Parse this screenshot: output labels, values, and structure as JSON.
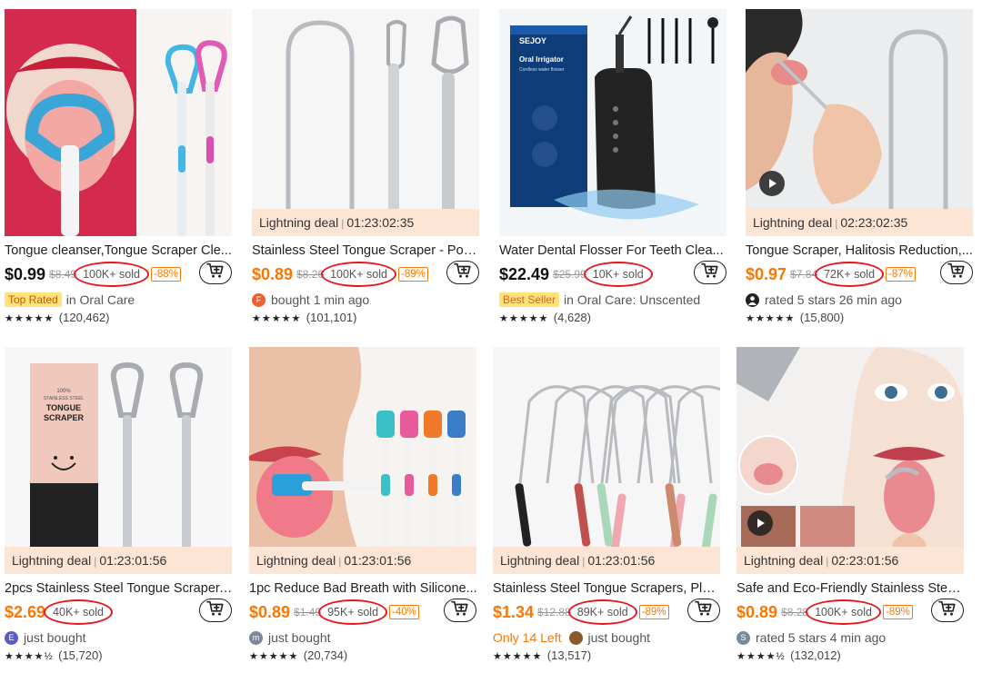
{
  "products": [
    {
      "title": "Tongue cleanser,Tongue Scraper Cle...",
      "price": "$0.99",
      "price_color": "black",
      "original_price": "$8.49",
      "sold": "100K+ sold",
      "discount": "-88%",
      "deal": null,
      "info": {
        "type": "badge",
        "badge": "Top Rated",
        "text": "in Oral Care"
      },
      "stars": "★★★★★",
      "reviews": "(120,462)"
    },
    {
      "title": "Stainless Steel Tongue Scraper - Port...",
      "price": "$0.89",
      "price_color": "orange",
      "original_price": "$8.26",
      "sold": "100K+ sold",
      "discount": "-89%",
      "deal": {
        "label": "Lightning deal",
        "timer": "01:23:02:35"
      },
      "info": {
        "type": "avatar",
        "avatar": "F",
        "avatar_color": "#f0602a",
        "text": "bought 1 min ago"
      },
      "stars": "★★★★★",
      "reviews": "(101,101)"
    },
    {
      "title": "Water Dental Flosser For Teeth Clea...",
      "price": "$22.49",
      "price_color": "black",
      "original_price": "$25.99",
      "sold": "10K+ sold",
      "discount": "",
      "deal": null,
      "info": {
        "type": "badge",
        "badge": "Best Seller",
        "text": "in Oral Care: Unscented"
      },
      "stars": "★★★★★",
      "reviews": "(4,628)"
    },
    {
      "title": "Tongue Scraper, Halitosis Reduction,...",
      "price": "$0.97",
      "price_color": "orange",
      "original_price": "$7.84",
      "sold": "72K+ sold",
      "discount": "-87%",
      "deal": {
        "label": "Lightning deal",
        "timer": "02:23:02:35"
      },
      "info": {
        "type": "avatar",
        "avatar": "",
        "avatar_color": "#222",
        "text": "rated 5 stars 26 min ago"
      },
      "stars": "★★★★★",
      "reviews": "(15,800)"
    },
    {
      "title": "2pcs Stainless Steel Tongue Scraper, ...",
      "price": "$2.69",
      "price_color": "orange",
      "original_price": "",
      "sold": "40K+ sold",
      "discount": "",
      "deal": {
        "label": "Lightning deal",
        "timer": "01:23:01:56"
      },
      "info": {
        "type": "avatar",
        "avatar": "E",
        "avatar_color": "#5a5acd",
        "text": "just bought"
      },
      "stars": "★★★★½",
      "reviews": "(15,720)"
    },
    {
      "title": "1pc Reduce Bad Breath with Silicone...",
      "price": "$0.89",
      "price_color": "orange",
      "original_price": "$1.49",
      "sold": "95K+ sold",
      "discount": "-40%",
      "deal": {
        "label": "Lightning deal",
        "timer": "01:23:01:56"
      },
      "info": {
        "type": "avatar",
        "avatar": "m",
        "avatar_color": "#7a8a9a",
        "text": "just bought"
      },
      "stars": "★★★★★",
      "reviews": "(20,734)"
    },
    {
      "title": "Stainless Steel Tongue Scrapers, Plas...",
      "price": "$1.34",
      "price_color": "orange",
      "original_price": "$12.88",
      "sold": "89K+ sold",
      "discount": "-89%",
      "deal": {
        "label": "Lightning deal",
        "timer": "01:23:01:56"
      },
      "info": {
        "type": "left",
        "left": "Only 14 Left",
        "avatar": "",
        "avatar_color": "#8b5a2b",
        "text": "just bought"
      },
      "stars": "★★★★★",
      "reviews": "(13,517)"
    },
    {
      "title": "Safe and Eco-Friendly Stainless Steel...",
      "price": "$0.89",
      "price_color": "orange",
      "original_price": "$8.28",
      "sold": "100K+ sold",
      "discount": "-89%",
      "deal": {
        "label": "Lightning deal",
        "timer": "02:23:01:56"
      },
      "info": {
        "type": "avatar",
        "avatar": "S",
        "avatar_color": "#7a8a9a",
        "text": "rated 5 stars 4 min ago"
      },
      "stars": "★★★★½",
      "reviews": "(132,012)"
    }
  ],
  "images": [
    {
      "kind": "mouth-blue-pink",
      "label": ""
    },
    {
      "kind": "three-metal-scrapers",
      "label": ""
    },
    {
      "kind": "water-flosser",
      "label": "SEJOY",
      "box_title": "Oral Irrigator",
      "box_sub": "Cordless water flosser"
    },
    {
      "kind": "man-using-scraper",
      "label": ""
    },
    {
      "kind": "box-two-scrapers",
      "box_lines": [
        "100%",
        "STAINLESS STEEL",
        "TONGUE",
        "SCRAPER"
      ]
    },
    {
      "kind": "silicone-brushes",
      "label": ""
    },
    {
      "kind": "colored-scrapers",
      "label": ""
    },
    {
      "kind": "woman-scraper",
      "label": ""
    }
  ],
  "icons": {
    "cart": "add-to-cart-icon",
    "play": "play-icon"
  },
  "colors": {
    "accent": "#fb7701",
    "deal_bg": "#fde5d6",
    "circle": "#e8151c"
  }
}
